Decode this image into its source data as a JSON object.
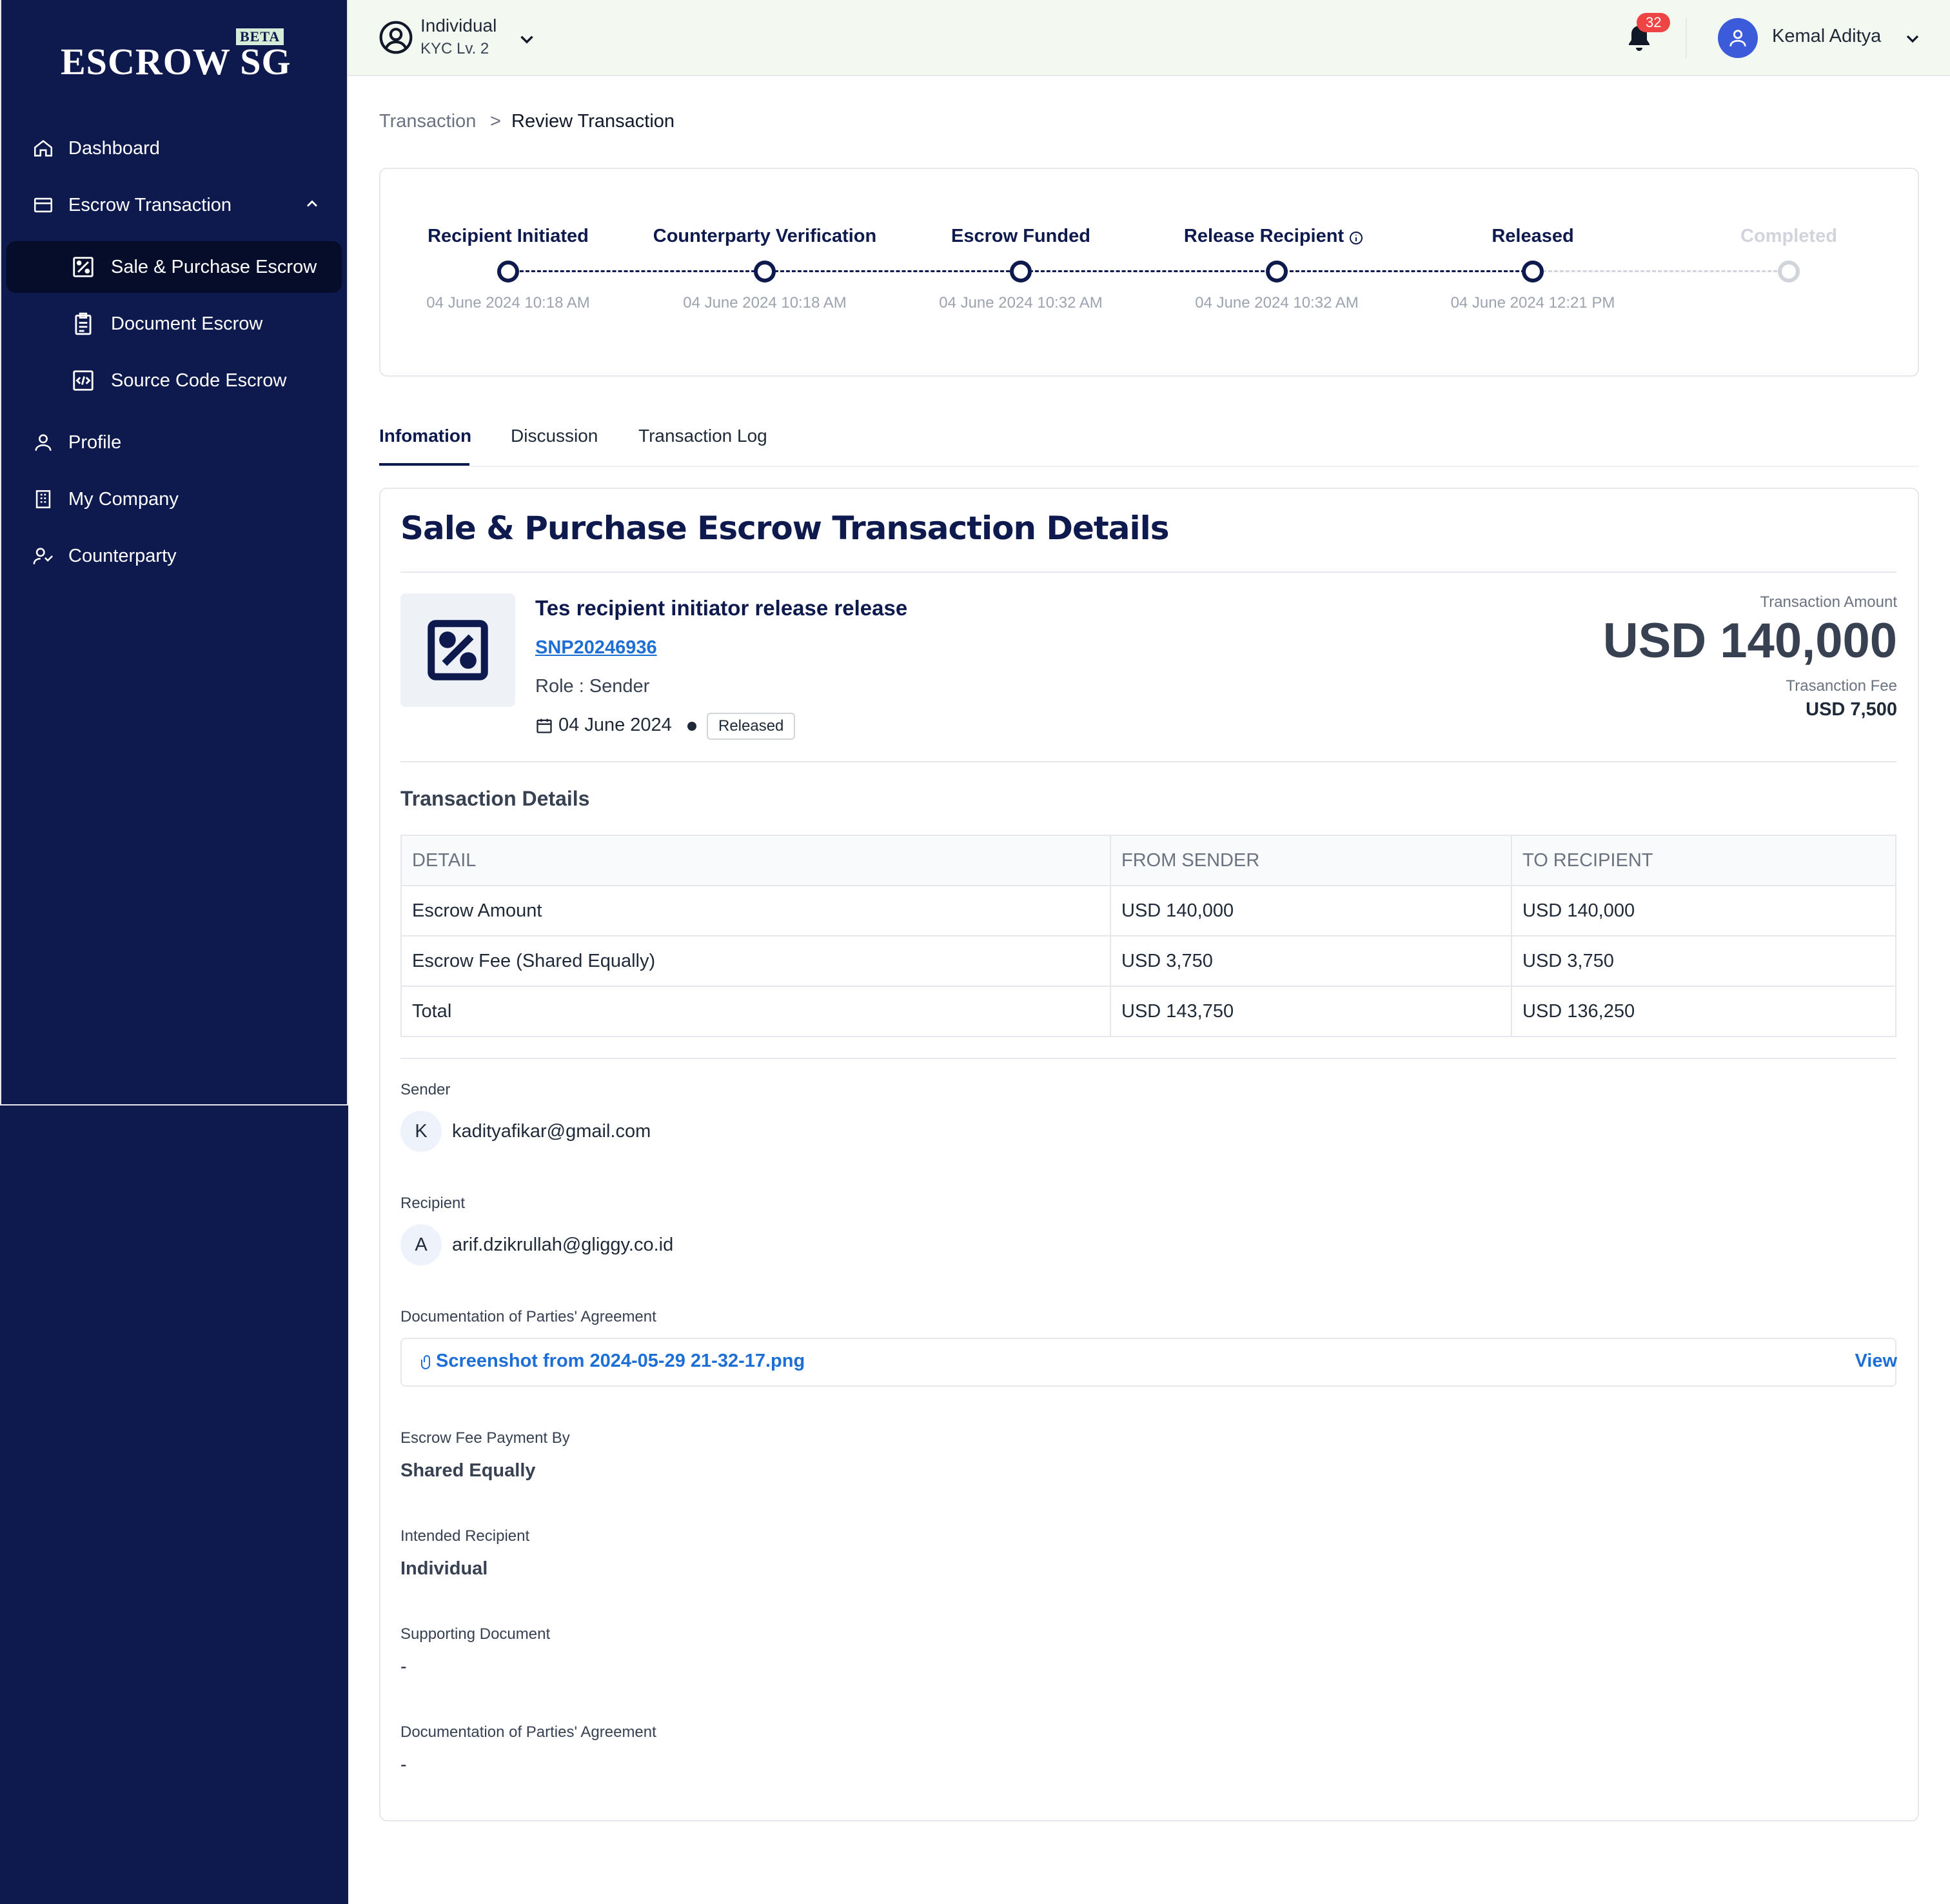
{
  "brand": {
    "name": "ESCROW SG",
    "badge": "BETA"
  },
  "sidebar": {
    "items": [
      {
        "label": "Dashboard",
        "icon": "home-icon"
      },
      {
        "label": "Escrow Transaction",
        "icon": "card-icon"
      },
      {
        "label": "Sale & Purchase Escrow",
        "icon": "percent-icon"
      },
      {
        "label": "Document Escrow",
        "icon": "clipboard-icon"
      },
      {
        "label": "Source Code Escrow",
        "icon": "code-icon"
      },
      {
        "label": "Profile",
        "icon": "user-icon"
      },
      {
        "label": "My Company",
        "icon": "building-icon"
      },
      {
        "label": "Counterparty",
        "icon": "users-icon"
      }
    ],
    "active": "Sale & Purchase Escrow"
  },
  "topbar": {
    "account_type": "Individual",
    "kyc": "KYC Lv. 2",
    "notifications": "32",
    "user_name": "Kemal Aditya"
  },
  "breadcrumb": {
    "parent": "Transaction",
    "separator": ">",
    "current": "Review Transaction"
  },
  "stepper": [
    {
      "label": "Recipient Initiated",
      "date": "04 June 2024 10:18 AM",
      "done": true
    },
    {
      "label": "Counterparty Verification",
      "date": "04 June 2024 10:18 AM",
      "done": true
    },
    {
      "label": "Escrow Funded",
      "date": "04 June 2024 10:32 AM",
      "done": true
    },
    {
      "label": "Release Recipient",
      "date": "04 June 2024 10:32 AM",
      "done": true
    },
    {
      "label": "Released",
      "date": "04 June 2024 12:21 PM",
      "done": true
    },
    {
      "label": "Completed",
      "date": "",
      "done": false
    }
  ],
  "tabs": [
    "Infomation",
    "Discussion",
    "Transaction Log"
  ],
  "details": {
    "section_title": "Sale & Purchase Escrow Transaction Details",
    "name": "Tes recipient initiator release release",
    "ref": "SNP20246936",
    "role": "Role : Sender",
    "date": "04 June 2024",
    "status": "Released",
    "amount_label": "Transaction Amount",
    "amount": "USD 140,000",
    "fee_label": "Trasanction Fee",
    "fee": "USD 7,500"
  },
  "table": {
    "title": "Transaction Details",
    "headers": [
      "DETAIL",
      "FROM SENDER",
      "TO RECIPIENT"
    ],
    "rows": [
      [
        "Escrow Amount",
        "USD 140,000",
        "USD 140,000"
      ],
      [
        "Escrow Fee (Shared Equally)",
        "USD 3,750",
        "USD 3,750"
      ],
      [
        "Total",
        "USD 143,750",
        "USD 136,250"
      ]
    ]
  },
  "sender": {
    "label": "Sender",
    "initial": "K",
    "email": "kadityafikar@gmail.com"
  },
  "recipient": {
    "label": "Recipient",
    "initial": "A",
    "email": "arif.dzikrullah@gliggy.co.id"
  },
  "agreement": {
    "label": "Documentation of Parties' Agreement",
    "file": "Screenshot from 2024-05-29 21-32-17.png",
    "action": "View"
  },
  "fee_payment": {
    "label": "Escrow Fee Payment By",
    "value": "Shared Equally"
  },
  "intended": {
    "label": "Intended Recipient",
    "value": "Individual"
  },
  "supporting": {
    "label": "Supporting Document",
    "value": "-"
  },
  "agreement2": {
    "label": "Documentation of Parties' Agreement",
    "value": "-"
  },
  "colors": {
    "navy": "#0e1a4e",
    "link": "#1d6fd6",
    "badge": "#ef4444",
    "topbar": "#f3f8f1"
  }
}
